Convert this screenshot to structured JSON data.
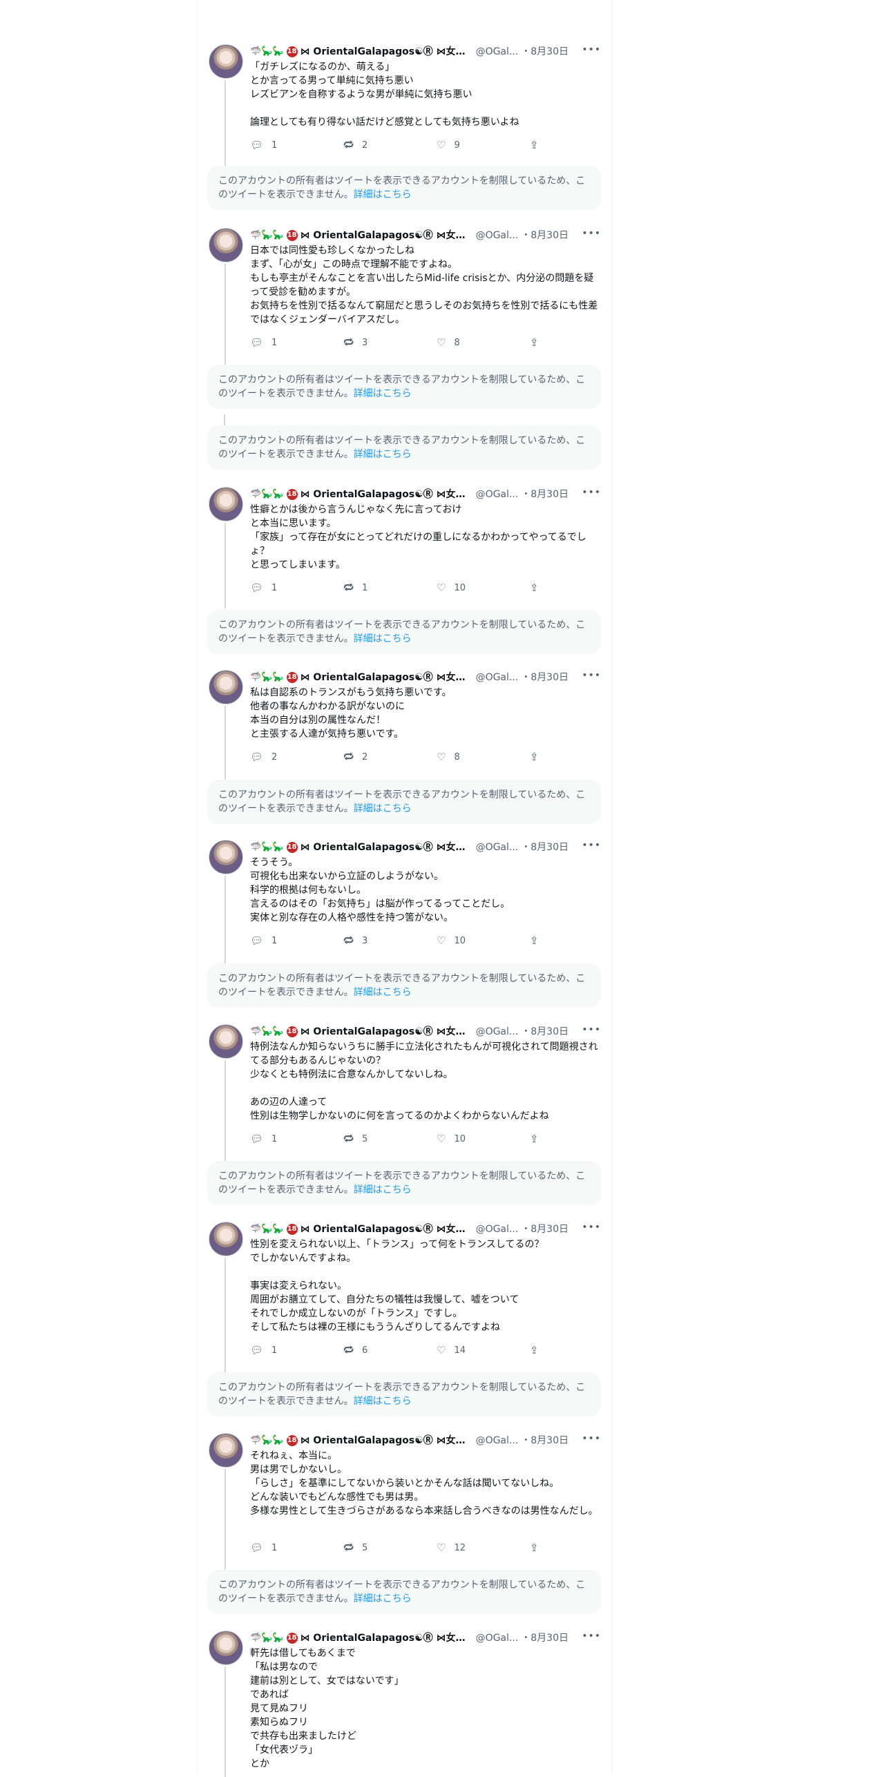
{
  "author": {
    "emoji_prefix": "🦈🦕🦕",
    "age_badge": "18",
    "display_name": "⋈ OrientalGalapagos☯Ⓡ ⋈女史(敬...",
    "handle": "@OGal...",
    "date": "・8月30日",
    "avatar_alt": "profile-avatar"
  },
  "restricted_notice": {
    "text": "このアカウントの所有者はツイートを表示できるアカウントを制限しているため、このツイートを表示できません。",
    "link": "詳細はこちら"
  },
  "tweets": [
    {
      "body": "「ガチレズになるのか、萌える」\nとか言ってる男って単純に気持ち悪い\nレズビアンを自称するような男が単純に気持ち悪い\n\n論理としても有り得ない話だけど感覚としても気持ち悪いよね",
      "replies": "1",
      "retweets": "2",
      "likes": "9"
    },
    {
      "body": "日本では同性愛も珍しくなかったしね\nまず、「心が女」この時点で理解不能ですよね。\nもしも亭主がそんなことを言い出したらMid-life crisisとか、内分泌の問題を疑って受診を勧めますが。\nお気持ちを性別で括るなんて窮屈だと思うしそのお気持ちを性別で括るにも性差ではなくジェンダーバイアスだし。",
      "replies": "1",
      "retweets": "3",
      "likes": "8"
    },
    {
      "body": "性癖とかは後から言うんじゃなく先に言っておけ\nと本当に思います。\n「家族」って存在が女にとってどれだけの重しになるかわかってやってるでしょ？\nと思ってしまいます。",
      "replies": "1",
      "retweets": "1",
      "likes": "10"
    },
    {
      "body": "私は自認系のトランスがもう気持ち悪いです。\n他者の事なんかわかる訳がないのに\n本当の自分は別の属性なんだ！\nと主張する人達が気持ち悪いです。",
      "replies": "2",
      "retweets": "2",
      "likes": "8"
    },
    {
      "body": "そうそう。\n可視化も出来ないから立証のしようがない。\n科学的根拠は何もないし。\n言えるのはその「お気持ち」は脳が作ってるってことだし。\n実体と別な存在の人格や感性を持つ筈がない。",
      "replies": "1",
      "retweets": "3",
      "likes": "10"
    },
    {
      "body": "特例法なんか知らないうちに勝手に立法化されたもんが可視化されて問題視されてる部分もあるんじゃないの？\n少なくとも特例法に合意なんかしてないしね。\n\nあの辺の人達って\n性別は生物学しかないのに何を言ってるのかよくわからないんだよね",
      "replies": "1",
      "retweets": "5",
      "likes": "10"
    },
    {
      "body": "性別を変えられない以上、「トランス」って何をトランスしてるの？\nでしかないんですよね。\n\n事実は変えられない。\n周囲がお膳立てして、自分たちの犠牲は我慢して、嘘をついて\nそれでしか成立しないのが「トランス」ですし。\nそして私たちは裸の王様にもううんざりしてるんですよね",
      "replies": "1",
      "retweets": "6",
      "likes": "14"
    },
    {
      "body": "それねぇ、本当に。\n男は男でしかないし。\n「らしさ」を基準にしてないから装いとかそんな話は聞いてないしね。\nどんな装いでもどんな感性でも男は男。\n多様な男性として生きづらさがあるなら本来話し合うべきなのは男性なんだし。",
      "replies": "1",
      "retweets": "5",
      "likes": "12"
    },
    {
      "body": "軒先は借してもあくまで\n「私は男なので\n建前は別として、女ではないです」\nであれば\n見て見ぬフリ\n素知らぬフリ\nで共存も出来ましたけど\n「女代表ヅラ」\nとか",
      "replies": "",
      "retweets": "",
      "likes": ""
    }
  ]
}
